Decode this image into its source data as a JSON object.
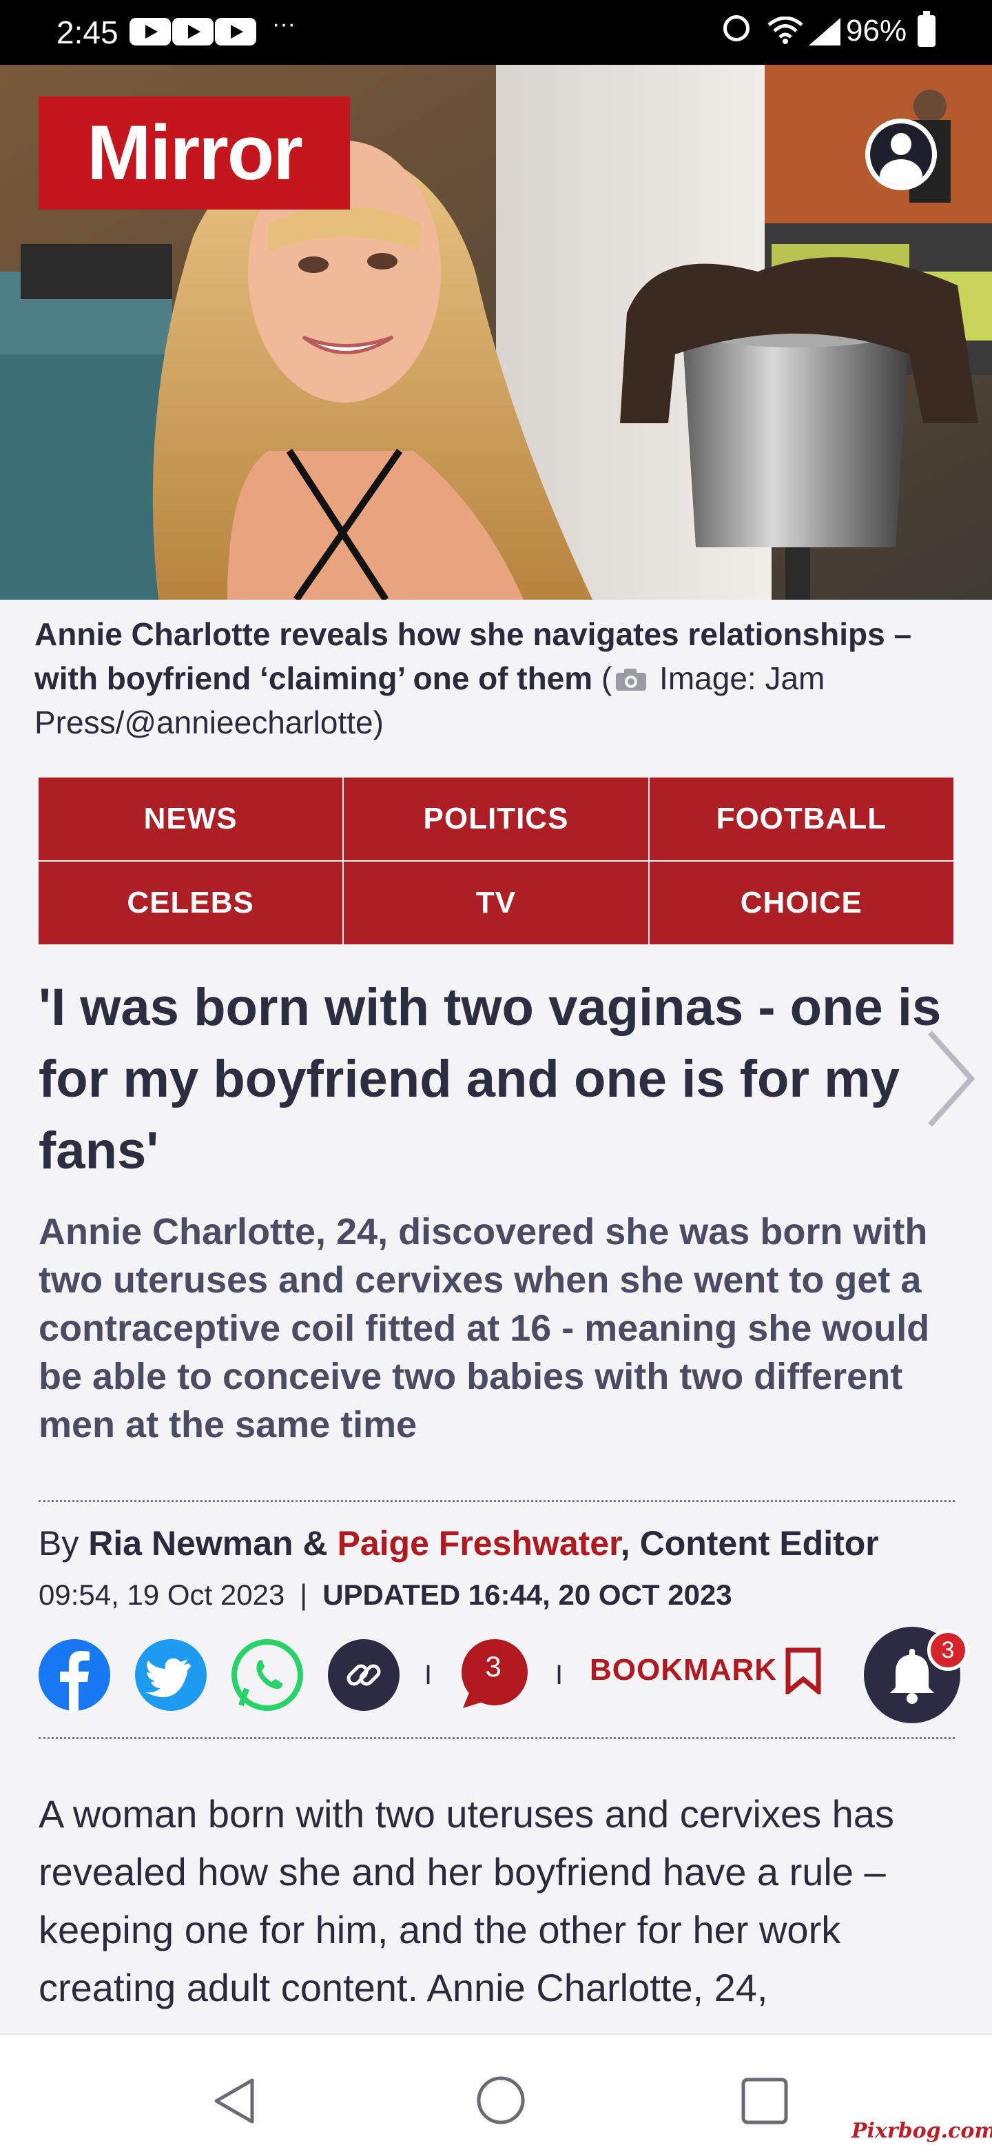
{
  "status_bar": {
    "time": "2:45",
    "overflow": "···",
    "battery": "96%",
    "icons": [
      "youtube-icon",
      "youtube-icon",
      "youtube-icon",
      "alarm-icon",
      "wifi-icon",
      "signal-icon",
      "battery-icon"
    ]
  },
  "header": {
    "logo": "Mirror",
    "account_icon": "account-icon"
  },
  "hero": {
    "caption_bold": "Annie Charlotte reveals how she navigates relationships – with boyfriend ‘claiming’ one of them",
    "caption_open": " (",
    "caption_credit": " Image: Jam Press/@annieecharlotte)"
  },
  "nav": {
    "items": [
      "NEWS",
      "POLITICS",
      "FOOTBALL",
      "CELEBS",
      "TV",
      "CHOICE"
    ]
  },
  "article": {
    "headline": "'I was born with two vaginas - one is for my boyfriend and one is for my fans'",
    "standfirst": "Annie Charlotte, 24, discovered she was born with two uteruses and cervixes when she went to get a contraceptive coil fitted at 16 - meaning she would be able to conceive two babies with two different men at the same time",
    "byline": {
      "by": "By ",
      "author1": "Ria Newman",
      "amp": " & ",
      "author2": "Paige Freshwater",
      "role": ", Content Editor"
    },
    "published": "09:54, 19 Oct 2023",
    "separator": "|",
    "updated": "UPDATED 16:44, 20 OCT 2023",
    "body": "A woman born with two uteruses and cervixes has revealed how she and her boyfriend have a rule – keeping one for him, and the other for her work creating adult content. Annie Charlotte, 24,"
  },
  "share": {
    "comment_count": "3",
    "bookmark_label": "BOOKMARK",
    "separator": "I",
    "notification_count": "3"
  },
  "watermark": "Pixrbog.com",
  "colors": {
    "brand": "#c4161c",
    "nav_bg": "#ad1f24",
    "facebook": "#1877f2",
    "twitter": "#1d9bf0",
    "whatsapp": "#25d366",
    "dark": "#2b2b44"
  }
}
